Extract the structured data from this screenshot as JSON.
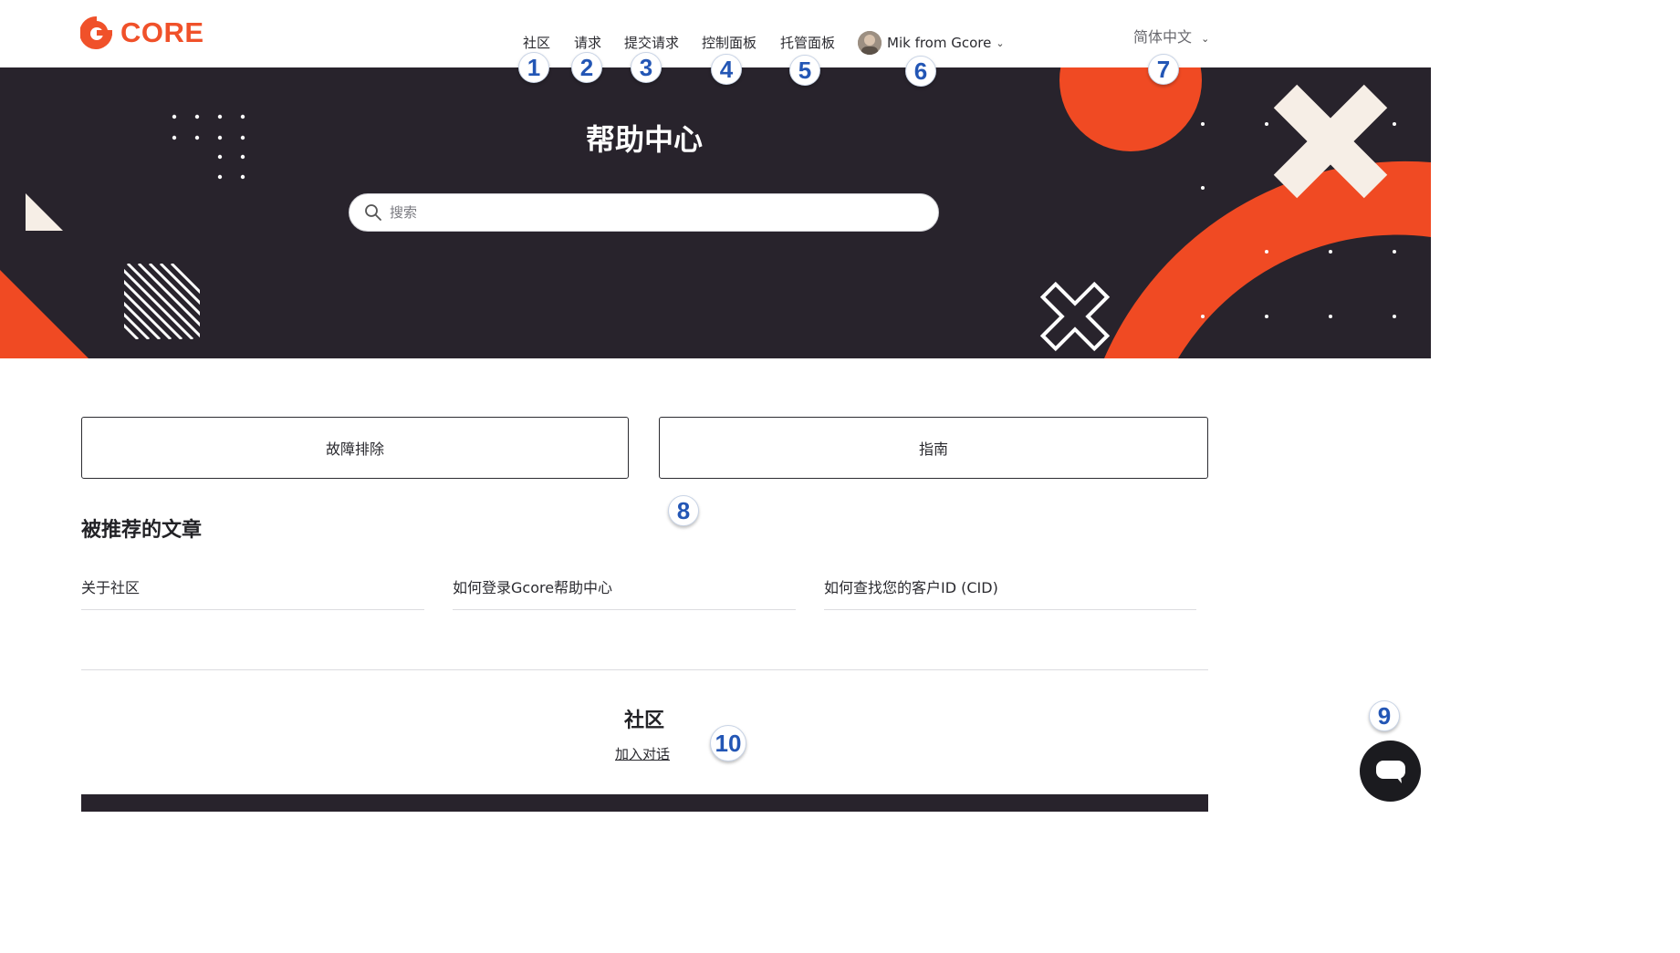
{
  "header": {
    "logo_text": "CORE",
    "nav": [
      "社区",
      "请求",
      "提交请求",
      "控制面板",
      "托管面板"
    ],
    "user_name": "Mik from Gcore",
    "language": "简体中文"
  },
  "hero": {
    "title": "帮助中心",
    "search_placeholder": "搜索"
  },
  "categories": [
    "故障排除",
    "指南"
  ],
  "promoted": {
    "title": "被推荐的文章",
    "articles": [
      "关于社区",
      "如何登录Gcore帮助中心",
      "如何查找您的客户ID (CID)"
    ]
  },
  "community": {
    "title": "社区",
    "link": "加入对话"
  },
  "markers": [
    "1",
    "2",
    "3",
    "4",
    "5",
    "6",
    "7",
    "8",
    "9",
    "10"
  ],
  "colors": {
    "brand": "#f0512a",
    "hero_bg": "#28232c",
    "marker_text": "#2356b5"
  }
}
